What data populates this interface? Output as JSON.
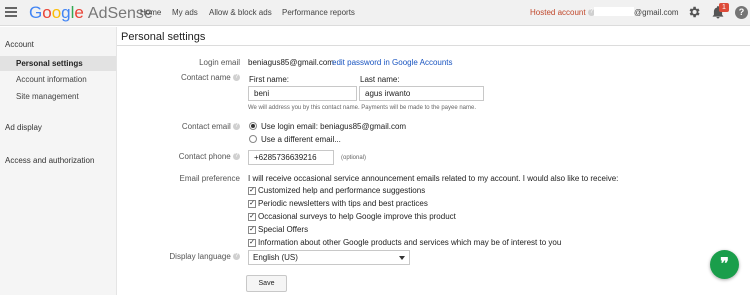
{
  "topbar": {
    "logo_google": [
      "G",
      "o",
      "o",
      "g",
      "l",
      "e"
    ],
    "logo_product": "AdSense",
    "nav": [
      "Home",
      "My ads",
      "Allow & block ads",
      "Performance reports"
    ],
    "hosted_account": "Hosted account",
    "help_glyph": "?",
    "email_suffix": "@gmail.com",
    "notification_count": "1",
    "help_button": "?",
    "icons": [
      "menu-icon",
      "gear-icon",
      "bell-icon",
      "help-icon"
    ]
  },
  "sidebar": {
    "account_heading": "Account",
    "items": [
      "Personal settings",
      "Account information",
      "Site management"
    ],
    "ad_display": "Ad display",
    "access": "Access and authorization"
  },
  "main": {
    "title": "Personal settings",
    "login_email_label": "Login email",
    "login_email_value": "beniagus85@gmail.com",
    "edit_password_link": "edit password in Google Accounts",
    "contact_name_label": "Contact name",
    "first_name_label": "First name:",
    "first_name_value": "beni",
    "last_name_label": "Last name:",
    "last_name_value": "agus irwanto",
    "name_note": "We will address you by this contact name. Payments will be made to the payee name.",
    "contact_email_label": "Contact email",
    "use_login_email": "Use login email: beniagus85@gmail.com",
    "use_different_email": "Use a different email...",
    "contact_phone_label": "Contact phone",
    "phone_value": "+6285736639216",
    "optional": "(optional)",
    "email_pref_label": "Email preference",
    "email_pref_intro": "I will receive occasional service announcement emails related to my account. I would also like to receive:",
    "preferences": [
      "Customized help and performance suggestions",
      "Periodic newsletters with tips and best practices",
      "Occasional surveys to help Google improve this product",
      "Special Offers",
      "Information about other Google products and services which may be of interest to you"
    ],
    "display_language_label": "Display language",
    "display_language_value": "English (US)",
    "save_label": "Save",
    "check_glyph": "✓"
  },
  "fab": {
    "glyph": "❞"
  }
}
